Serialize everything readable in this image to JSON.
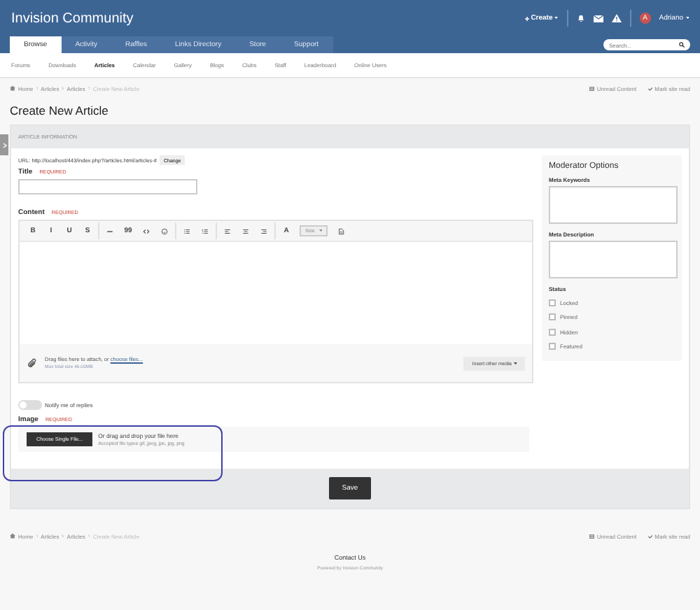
{
  "header": {
    "site_title": "Invision Community",
    "create": "Create",
    "user": "Adriano",
    "avatar_letter": "A",
    "search": {
      "placeholder": "Search..."
    }
  },
  "tabs": [
    {
      "label": "Browse",
      "selected": true
    },
    {
      "label": "Activity",
      "selected": false
    },
    {
      "label": "Raffles",
      "selected": false
    },
    {
      "label": "Links Directory",
      "selected": false
    },
    {
      "label": "Store",
      "selected": false
    },
    {
      "label": "Support",
      "selected": false
    }
  ],
  "subnav": [
    {
      "label": "Forums",
      "selected": false
    },
    {
      "label": "Downloads",
      "selected": false
    },
    {
      "label": "Articles",
      "selected": true
    },
    {
      "label": "Calendar",
      "selected": false
    },
    {
      "label": "Gallery",
      "selected": false
    },
    {
      "label": "Blogs",
      "selected": false
    },
    {
      "label": "Clubs",
      "selected": false
    },
    {
      "label": "Staff",
      "selected": false
    },
    {
      "label": "Leaderboard",
      "selected": false
    },
    {
      "label": "Online Users",
      "selected": false
    }
  ],
  "breadcrumb": [
    "Home",
    "Articles",
    "Articles",
    "Create New Article"
  ],
  "quick_links": [
    "Unread Content",
    "Mark site read"
  ],
  "breadcrumb_bottom": [
    "Home",
    "Articles",
    "Articles",
    "Create New Article"
  ],
  "quick_links_bottom": [
    "Unread Content",
    "Mark site read"
  ],
  "page_title": "Create New Article",
  "panel_title": "ARTICLE INFORMATION",
  "url": {
    "text": "URL: http://localhost/443/index.php?/articles.html/articles-#",
    "button": "Change"
  },
  "title_field": {
    "label": "Title",
    "required": "REQUIRED"
  },
  "content": {
    "label": "Content",
    "required": "REQUIRED",
    "size": "Size",
    "toolbar": [
      {
        "kind": "text",
        "label": "B"
      },
      {
        "kind": "text",
        "label": "I"
      },
      {
        "kind": "text",
        "label": "U"
      },
      {
        "kind": "text",
        "label": "S"
      },
      {
        "kind": "sep"
      },
      {
        "kind": "rule"
      },
      {
        "kind": "text",
        "label": "99"
      },
      {
        "kind": "code"
      },
      {
        "kind": "smile"
      },
      {
        "kind": "sep"
      },
      {
        "kind": "bullets"
      },
      {
        "kind": "numbers"
      },
      {
        "kind": "sep"
      },
      {
        "kind": "left"
      },
      {
        "kind": "center"
      },
      {
        "kind": "right"
      },
      {
        "kind": "sep"
      },
      {
        "kind": "text",
        "label": "A"
      },
      {
        "kind": "size"
      },
      {
        "kind": "doc"
      }
    ],
    "attach_text": "Drag files here to attach, or ",
    "attach_link": "choose files...",
    "max_size": "Max total size 46.03MB",
    "insert_media": "Insert other media"
  },
  "notify": {
    "label": "Notify me of replies",
    "on": false
  },
  "image": {
    "label": "Image",
    "required": "REQUIRED",
    "button": "Choose Single File...",
    "drop": "Or drag and drop your file here",
    "accepted": "Accepted file types gif, jpeg, jpe, jpg, png"
  },
  "save": "Save",
  "moderator": {
    "title": "Moderator Options",
    "keywords": "Meta Keywords",
    "description": "Meta Description",
    "status": "Status",
    "checks": [
      {
        "label": "Locked",
        "checked": false
      },
      {
        "label": "Pinned",
        "checked": false
      },
      {
        "label": "Hidden",
        "checked": false
      },
      {
        "label": "Featured",
        "checked": false
      }
    ]
  },
  "footer": {
    "contact": "Contact Us",
    "powered": "Powered by Invision Community"
  }
}
